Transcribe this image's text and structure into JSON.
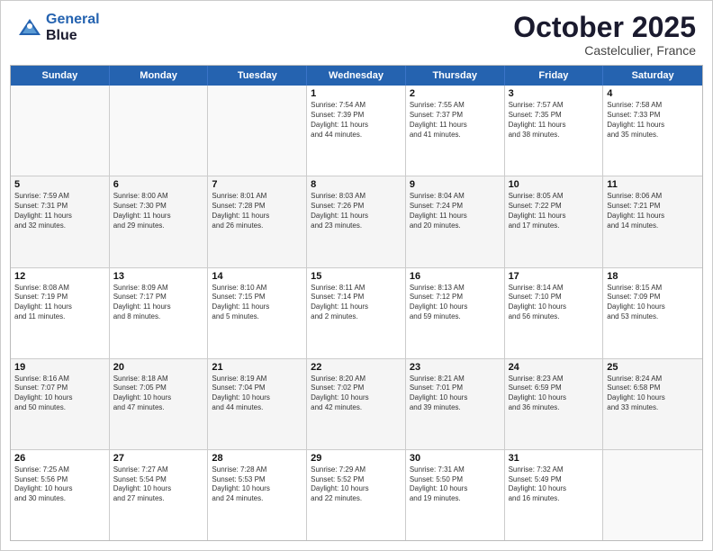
{
  "header": {
    "logo_line1": "General",
    "logo_line2": "Blue",
    "month_title": "October 2025",
    "location": "Castelculier, France"
  },
  "weekdays": [
    "Sunday",
    "Monday",
    "Tuesday",
    "Wednesday",
    "Thursday",
    "Friday",
    "Saturday"
  ],
  "rows": [
    [
      {
        "day": "",
        "info": ""
      },
      {
        "day": "",
        "info": ""
      },
      {
        "day": "",
        "info": ""
      },
      {
        "day": "1",
        "info": "Sunrise: 7:54 AM\nSunset: 7:39 PM\nDaylight: 11 hours\nand 44 minutes."
      },
      {
        "day": "2",
        "info": "Sunrise: 7:55 AM\nSunset: 7:37 PM\nDaylight: 11 hours\nand 41 minutes."
      },
      {
        "day": "3",
        "info": "Sunrise: 7:57 AM\nSunset: 7:35 PM\nDaylight: 11 hours\nand 38 minutes."
      },
      {
        "day": "4",
        "info": "Sunrise: 7:58 AM\nSunset: 7:33 PM\nDaylight: 11 hours\nand 35 minutes."
      }
    ],
    [
      {
        "day": "5",
        "info": "Sunrise: 7:59 AM\nSunset: 7:31 PM\nDaylight: 11 hours\nand 32 minutes."
      },
      {
        "day": "6",
        "info": "Sunrise: 8:00 AM\nSunset: 7:30 PM\nDaylight: 11 hours\nand 29 minutes."
      },
      {
        "day": "7",
        "info": "Sunrise: 8:01 AM\nSunset: 7:28 PM\nDaylight: 11 hours\nand 26 minutes."
      },
      {
        "day": "8",
        "info": "Sunrise: 8:03 AM\nSunset: 7:26 PM\nDaylight: 11 hours\nand 23 minutes."
      },
      {
        "day": "9",
        "info": "Sunrise: 8:04 AM\nSunset: 7:24 PM\nDaylight: 11 hours\nand 20 minutes."
      },
      {
        "day": "10",
        "info": "Sunrise: 8:05 AM\nSunset: 7:22 PM\nDaylight: 11 hours\nand 17 minutes."
      },
      {
        "day": "11",
        "info": "Sunrise: 8:06 AM\nSunset: 7:21 PM\nDaylight: 11 hours\nand 14 minutes."
      }
    ],
    [
      {
        "day": "12",
        "info": "Sunrise: 8:08 AM\nSunset: 7:19 PM\nDaylight: 11 hours\nand 11 minutes."
      },
      {
        "day": "13",
        "info": "Sunrise: 8:09 AM\nSunset: 7:17 PM\nDaylight: 11 hours\nand 8 minutes."
      },
      {
        "day": "14",
        "info": "Sunrise: 8:10 AM\nSunset: 7:15 PM\nDaylight: 11 hours\nand 5 minutes."
      },
      {
        "day": "15",
        "info": "Sunrise: 8:11 AM\nSunset: 7:14 PM\nDaylight: 11 hours\nand 2 minutes."
      },
      {
        "day": "16",
        "info": "Sunrise: 8:13 AM\nSunset: 7:12 PM\nDaylight: 10 hours\nand 59 minutes."
      },
      {
        "day": "17",
        "info": "Sunrise: 8:14 AM\nSunset: 7:10 PM\nDaylight: 10 hours\nand 56 minutes."
      },
      {
        "day": "18",
        "info": "Sunrise: 8:15 AM\nSunset: 7:09 PM\nDaylight: 10 hours\nand 53 minutes."
      }
    ],
    [
      {
        "day": "19",
        "info": "Sunrise: 8:16 AM\nSunset: 7:07 PM\nDaylight: 10 hours\nand 50 minutes."
      },
      {
        "day": "20",
        "info": "Sunrise: 8:18 AM\nSunset: 7:05 PM\nDaylight: 10 hours\nand 47 minutes."
      },
      {
        "day": "21",
        "info": "Sunrise: 8:19 AM\nSunset: 7:04 PM\nDaylight: 10 hours\nand 44 minutes."
      },
      {
        "day": "22",
        "info": "Sunrise: 8:20 AM\nSunset: 7:02 PM\nDaylight: 10 hours\nand 42 minutes."
      },
      {
        "day": "23",
        "info": "Sunrise: 8:21 AM\nSunset: 7:01 PM\nDaylight: 10 hours\nand 39 minutes."
      },
      {
        "day": "24",
        "info": "Sunrise: 8:23 AM\nSunset: 6:59 PM\nDaylight: 10 hours\nand 36 minutes."
      },
      {
        "day": "25",
        "info": "Sunrise: 8:24 AM\nSunset: 6:58 PM\nDaylight: 10 hours\nand 33 minutes."
      }
    ],
    [
      {
        "day": "26",
        "info": "Sunrise: 7:25 AM\nSunset: 5:56 PM\nDaylight: 10 hours\nand 30 minutes."
      },
      {
        "day": "27",
        "info": "Sunrise: 7:27 AM\nSunset: 5:54 PM\nDaylight: 10 hours\nand 27 minutes."
      },
      {
        "day": "28",
        "info": "Sunrise: 7:28 AM\nSunset: 5:53 PM\nDaylight: 10 hours\nand 24 minutes."
      },
      {
        "day": "29",
        "info": "Sunrise: 7:29 AM\nSunset: 5:52 PM\nDaylight: 10 hours\nand 22 minutes."
      },
      {
        "day": "30",
        "info": "Sunrise: 7:31 AM\nSunset: 5:50 PM\nDaylight: 10 hours\nand 19 minutes."
      },
      {
        "day": "31",
        "info": "Sunrise: 7:32 AM\nSunset: 5:49 PM\nDaylight: 10 hours\nand 16 minutes."
      },
      {
        "day": "",
        "info": ""
      }
    ]
  ]
}
